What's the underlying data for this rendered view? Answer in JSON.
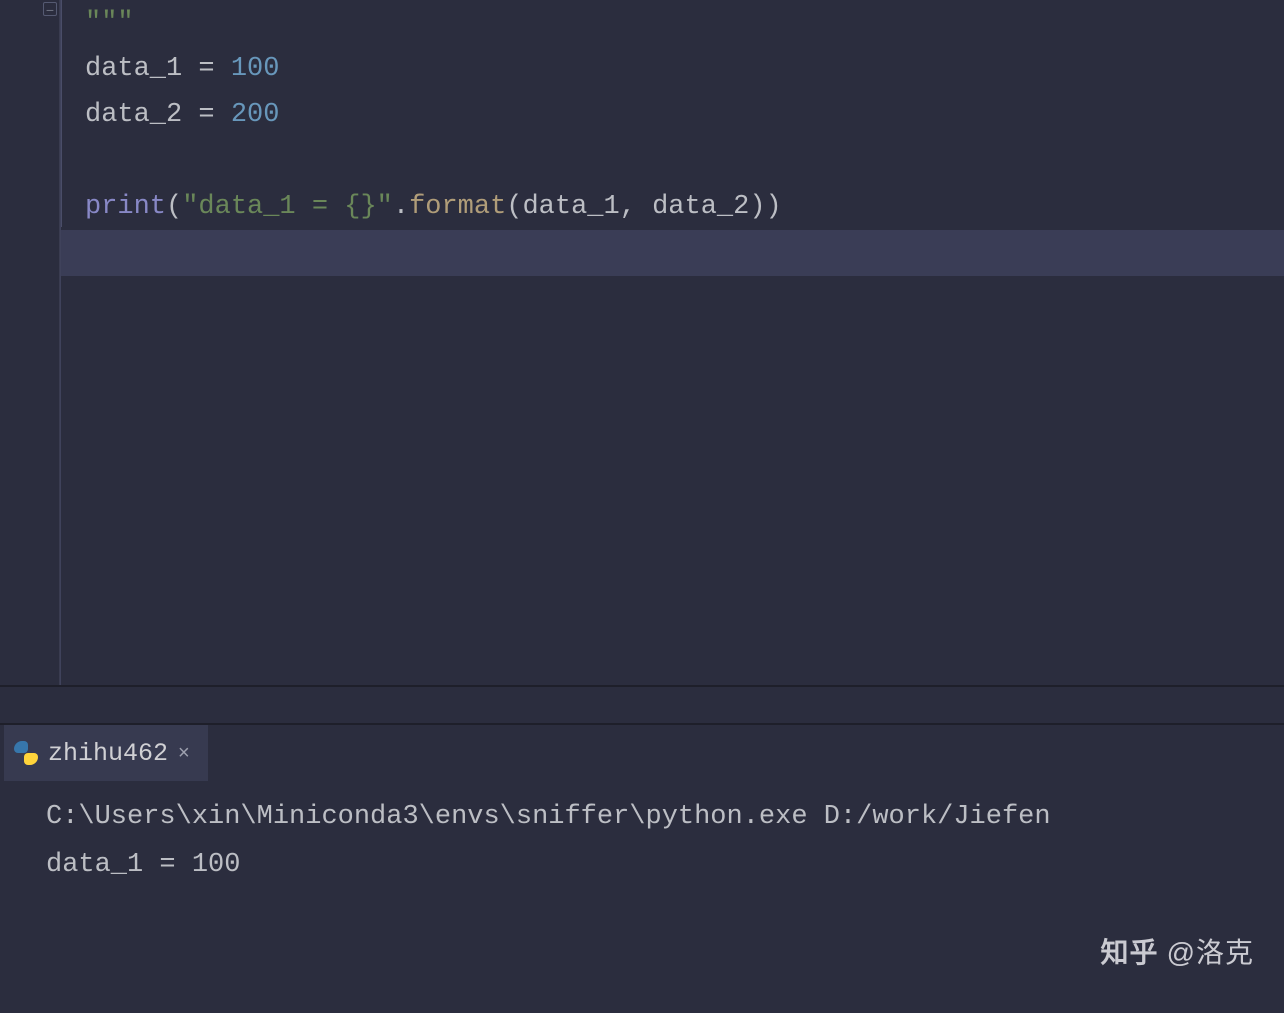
{
  "editor": {
    "docstring_ticks": "\"\"\"",
    "lines": {
      "l1": {
        "var": "data_1",
        "op": " = ",
        "num": "100"
      },
      "l2": {
        "var": "data_2",
        "op": " = ",
        "num": "200"
      },
      "l3": {
        "builtin": "print",
        "open": "(",
        "str": "\"data_1 = {}\"",
        "dot": ".",
        "fn": "format",
        "open2": "(",
        "arg1": "data_1",
        "comma": ", ",
        "arg2": "data_2",
        "close2": ")",
        "close": ")"
      }
    }
  },
  "terminal": {
    "tab_label": "zhihu462",
    "command": "C:\\Users\\xin\\Miniconda3\\envs\\sniffer\\python.exe D:/work/Jiefen",
    "output": "data_1 = 100"
  },
  "watermark": {
    "logo": "知乎",
    "text": "@洛克"
  }
}
